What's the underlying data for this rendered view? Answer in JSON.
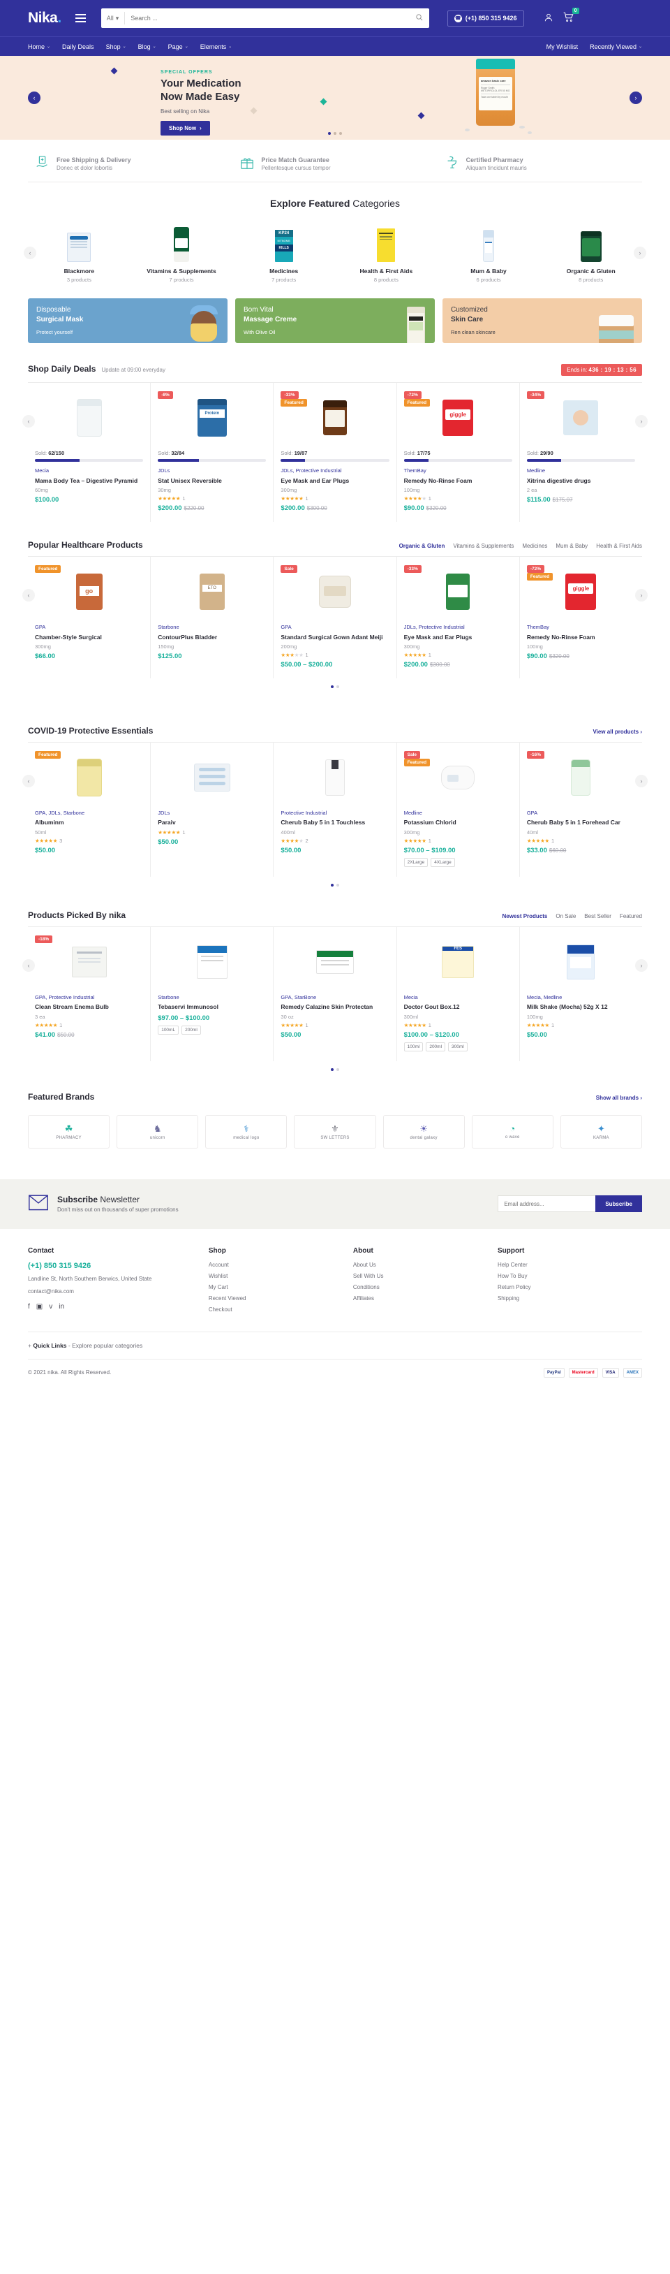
{
  "header": {
    "logo": "Nika",
    "logo_dot": ".",
    "search": {
      "category": "All",
      "placeholder": "Search ...",
      "value": ""
    },
    "phone": "(+1) 850 315 9426",
    "cart_count": "0"
  },
  "nav": {
    "items": [
      {
        "label": "Home",
        "caret": "⌄"
      },
      {
        "label": "Daily Deals",
        "caret": ""
      },
      {
        "label": "Shop",
        "caret": "⌄"
      },
      {
        "label": "Blog",
        "caret": "⌄"
      },
      {
        "label": "Page",
        "caret": "⌄"
      },
      {
        "label": "Elements",
        "caret": "⌄"
      }
    ],
    "right": [
      {
        "label": "My Wishlist",
        "caret": ""
      },
      {
        "label": "Recently Viewed",
        "caret": "⌄"
      }
    ]
  },
  "hero": {
    "eyebrow": "SPECIAL OFFERS",
    "title_line1": "Your Medication",
    "title_line2": "Now Made Easy",
    "subtitle": "Best selling on Nika",
    "button": "Shop Now",
    "button_caret": "›",
    "prev": "‹",
    "next": "›",
    "bottle_brand": "amazon basic care",
    "bottle_name": "Roger Smith",
    "bottle_drug": "METOPROLOL ER 50 MG",
    "bottle_note": "Take one tablet by mouth"
  },
  "features": [
    {
      "icon": "shipping-icon",
      "title": "Free Shipping & Delivery",
      "sub": "Donec et dolor lobortis"
    },
    {
      "icon": "gift-icon",
      "title": "Price Match Guarantee",
      "sub": "Pellentesque cursus tempor"
    },
    {
      "icon": "pharmacy-icon",
      "title": "Certified Pharmacy",
      "sub": "Aliquam tincidunt mauris"
    }
  ],
  "categories_section": {
    "title_bold": "Explore Featured",
    "title_thin": " Categories",
    "prev": "‹",
    "next": "›",
    "items": [
      {
        "name": "Blackmore",
        "count": "3 products"
      },
      {
        "name": "Vitamins & Supplements",
        "count": "7 products"
      },
      {
        "name": "Medicines",
        "count": "7 products"
      },
      {
        "name": "Health & First Aids",
        "count": "8 products"
      },
      {
        "name": "Mum & Baby",
        "count": "6 products"
      },
      {
        "name": "Organic & Gluten",
        "count": "8 products"
      }
    ]
  },
  "promos": [
    {
      "line1": "Disposable",
      "line2": "Surgical Mask",
      "sub": "Protect yourself"
    },
    {
      "line1": "Bom Vital",
      "line2": "Massage Creme",
      "sub": "With Olive Oil"
    },
    {
      "line1": "Customized",
      "line2": "Skin Care",
      "sub": "Ren clean skincare"
    }
  ],
  "daily_deals": {
    "title": "Shop Daily Deals",
    "note": "Update at 09:00 everyday",
    "ends_label": "Ends in:",
    "countdown": "436 : 19 : 13 : 56",
    "prev": "‹",
    "next": "›",
    "products": [
      {
        "tags": [],
        "sold": "Sold: ",
        "sold_val": "62/150",
        "progress": 41,
        "brand": "Mecia",
        "name": "Mama Body Tea – Digestive Pyramid",
        "dose": "60mg",
        "stars": 0,
        "rating_count": "",
        "price": "$100.00",
        "old_price": "",
        "art": "m-bottlewhite"
      },
      {
        "tags": [
          {
            "text": "-8%",
            "color": "red"
          }
        ],
        "sold": "Sold: ",
        "sold_val": "32/84",
        "progress": 38,
        "brand": "JDLs",
        "name": "Stat Unisex Reversible",
        "dose": "30mg",
        "stars": 5,
        "rating_count": "1",
        "price": "$200.00",
        "old_price": "$220.00",
        "art": "m-protein"
      },
      {
        "tags": [
          {
            "text": "-33%",
            "color": "red"
          },
          {
            "text": "Featured",
            "color": "orange"
          }
        ],
        "sold": "Sold: ",
        "sold_val": "19/87",
        "progress": 22,
        "brand": "JDLs, Protective Industrial",
        "name": "Eye Mask and Ear Plugs",
        "dose": "300mg",
        "stars": 5,
        "rating_count": "1",
        "price": "$200.00",
        "old_price": "$300.00",
        "art": "m-amber"
      },
      {
        "tags": [
          {
            "text": "-72%",
            "color": "red"
          },
          {
            "text": "Featured",
            "color": "orange"
          }
        ],
        "sold": "Sold: ",
        "sold_val": "17/75",
        "progress": 23,
        "brand": "ThemBay",
        "name": "Remedy No-Rinse Foam",
        "dose": "100mg",
        "stars": 4,
        "rating_count": "1",
        "price": "$90.00",
        "old_price": "$320.00",
        "art": "m-red"
      },
      {
        "tags": [
          {
            "text": "-34%",
            "color": "red"
          }
        ],
        "sold": "Sold: ",
        "sold_val": "29/90",
        "progress": 32,
        "brand": "Medline",
        "name": "Xitrina digestive drugs",
        "dose": "2 ea",
        "stars": 0,
        "rating_count": "",
        "price": "$115.00",
        "old_price": "$175.07",
        "art": "m-baby"
      }
    ]
  },
  "popular": {
    "title": "Popular Healthcare Products",
    "tabs": [
      {
        "label": "Organic & Gluten",
        "active": true
      },
      {
        "label": "Vitamins & Supplements",
        "active": false
      },
      {
        "label": "Medicines",
        "active": false
      },
      {
        "label": "Mum & Baby",
        "active": false
      },
      {
        "label": "Health & First Aids",
        "active": false
      }
    ],
    "prev": "‹",
    "next": "›",
    "products": [
      {
        "tags": [
          {
            "text": "Featured",
            "color": "orange"
          }
        ],
        "brand": "GPA",
        "name": "Chamber-Style Surgical",
        "dose": "300mg",
        "stars": 0,
        "rating_count": "",
        "price": "$66.00",
        "old_price": "",
        "art": "m-gogo"
      },
      {
        "tags": [],
        "brand": "Starbone",
        "name": "ContourPlus Bladder",
        "dose": "150mg",
        "stars": 0,
        "rating_count": "",
        "price": "$125.00",
        "old_price": "",
        "art": "m-tan"
      },
      {
        "tags": [
          {
            "text": "Sale",
            "color": "red"
          }
        ],
        "brand": "GPA",
        "name": "Standard Surgical Gown Adant Meiji",
        "dose": "200mg",
        "stars": 3,
        "rating_count": "1",
        "price": "$50.00 – $200.00",
        "old_price": "",
        "art": "m-pouch"
      },
      {
        "tags": [
          {
            "text": "-33%",
            "color": "red"
          }
        ],
        "brand": "JDLs, Protective Industrial",
        "name": "Eye Mask and Ear Plugs",
        "dose": "300mg",
        "stars": 5,
        "rating_count": "1",
        "price": "$200.00",
        "old_price": "$300.00",
        "art": "m-green"
      },
      {
        "tags": [
          {
            "text": "-72%",
            "color": "red"
          },
          {
            "text": "Featured",
            "color": "orange"
          }
        ],
        "brand": "ThemBay",
        "name": "Remedy No-Rinse Foam",
        "dose": "100mg",
        "stars": 0,
        "rating_count": "",
        "price": "$90.00",
        "old_price": "$320.00",
        "art": "m-red"
      }
    ]
  },
  "covid": {
    "title": "COVID-19 Protective Essentials",
    "view_all": "View all products",
    "view_all_caret": "›",
    "prev": "‹",
    "next": "›",
    "products": [
      {
        "tags": [
          {
            "text": "Featured",
            "color": "orange"
          }
        ],
        "brand": "GPA, JDLs, Starbone",
        "name": "Albuminm",
        "dose": "50ml",
        "stars": 5,
        "rating_count": "3",
        "price": "$50.00",
        "old_price": "",
        "art": "m-yellowb",
        "variants": []
      },
      {
        "tags": [],
        "brand": "JDLs",
        "name": "Paraiv",
        "dose": "",
        "stars": 5,
        "rating_count": "1",
        "price": "$50.00",
        "old_price": "",
        "art": "m-masks",
        "variants": []
      },
      {
        "tags": [],
        "brand": "Protective Industrial",
        "name": "Cherub Baby 5 in 1 Touchless",
        "dose": "400ml",
        "stars": 4,
        "rating_count": "2",
        "price": "$50.00",
        "old_price": "",
        "art": "m-pump",
        "variants": []
      },
      {
        "tags": [
          {
            "text": "Sale",
            "color": "red"
          },
          {
            "text": "Featured",
            "color": "orange"
          }
        ],
        "brand": "Medline",
        "name": "Potassium Chlorid",
        "dose": "300mg",
        "stars": 5,
        "rating_count": "1",
        "price": "$70.00 – $109.00",
        "old_price": "",
        "art": "m-therm",
        "variants": [
          "2XLarge",
          "4XLarge"
        ]
      },
      {
        "tags": [
          {
            "text": "-16%",
            "color": "red"
          }
        ],
        "brand": "GPA",
        "name": "Cherub Baby 5 in 1 Forehead Car",
        "dose": "40ml",
        "stars": 5,
        "rating_count": "1",
        "price": "$33.00",
        "old_price": "$60.00",
        "art": "m-greenb",
        "variants": []
      }
    ]
  },
  "picked": {
    "title": "Products Picked By nika",
    "tabs": [
      {
        "label": "Newest Products",
        "active": true
      },
      {
        "label": "On Sale",
        "active": false
      },
      {
        "label": "Best Seller",
        "active": false
      },
      {
        "label": "Featured",
        "active": false
      }
    ],
    "prev": "‹",
    "next": "›",
    "products": [
      {
        "tags": [
          {
            "text": "-18%",
            "color": "red"
          }
        ],
        "brand": "GPA, Protective Industrial",
        "name": "Clean Stream Enema Bulb",
        "dose": "3 ea",
        "stars": 5,
        "rating_count": "1",
        "price": "$41.00",
        "old_price": "$50.00",
        "art": "m-boxw",
        "variants": []
      },
      {
        "tags": [],
        "brand": "Starbone",
        "name": "Tebaservi Immunosol",
        "dose": "",
        "stars": 0,
        "rating_count": "",
        "price": "$97.00 – $100.00",
        "old_price": "",
        "art": "m-boxb",
        "variants": [
          "100mL",
          "200ml"
        ]
      },
      {
        "tags": [],
        "brand": "GPA, StarBone",
        "name": "Remedy Calazine Skin Protectan",
        "dose": "30 oz",
        "stars": 5,
        "rating_count": "1",
        "price": "$50.00",
        "old_price": "",
        "art": "m-boxgreen",
        "variants": []
      },
      {
        "tags": [],
        "brand": "Mecia",
        "name": "Doctor Gout Box.12",
        "dose": "300ml",
        "stars": 5,
        "rating_count": "1",
        "price": "$100.00 – $120.00",
        "old_price": "",
        "art": "m-fes",
        "variants": [
          "100ml",
          "200ml",
          "300ml"
        ]
      },
      {
        "tags": [],
        "brand": "Mecia, Medline",
        "name": "Milk Shake (Mocha) 52g X 12",
        "dose": "100mg",
        "stars": 5,
        "rating_count": "1",
        "price": "$50.00",
        "old_price": "",
        "art": "m-otri",
        "variants": []
      }
    ]
  },
  "brands_section": {
    "title": "Featured Brands",
    "show_all": "Show all brands",
    "show_all_caret": "›",
    "items": [
      {
        "icon": "☘",
        "name": "PHARMACY"
      },
      {
        "icon": "♞",
        "name": "unicorn"
      },
      {
        "icon": "⚕",
        "name": "medical logo"
      },
      {
        "icon": "⚜",
        "name": "SW LETTERS"
      },
      {
        "icon": "☀",
        "name": "dental galaxy"
      },
      {
        "icon": "◔",
        "name": "o wave"
      },
      {
        "icon": "✦",
        "name": "KARMA"
      }
    ]
  },
  "newsletter": {
    "title_bold": "Subscribe",
    "title_thin": " Newsletter",
    "sub": "Don't miss out on thousands of super promotions",
    "placeholder": "Email address...",
    "button": "Subscribe"
  },
  "footer": {
    "columns": [
      {
        "heading": "Contact",
        "tel": "(+1) 850 315 9426",
        "address": "Landline St, North Southern Berwics, United State",
        "email": "contact@nika.com",
        "socials": [
          "facebook-icon",
          "instagram-icon",
          "twitter-icon",
          "linkedin-icon"
        ],
        "social_glyphs": [
          "f",
          "▣",
          "ᴠ",
          "in"
        ]
      },
      {
        "heading": "Shop",
        "links": [
          "Account",
          "Wishlist",
          "My Cart",
          "Recent Viewed",
          "Checkout"
        ]
      },
      {
        "heading": "About",
        "links": [
          "About Us",
          "Sell With Us",
          "Conditions",
          "Affiliates"
        ]
      },
      {
        "heading": "Support",
        "links": [
          "Help Center",
          "How To Buy",
          "Return Policy",
          "Shipping"
        ]
      }
    ],
    "quick_plus": "+",
    "quick_bold": "Quick Links",
    "quick_rest": "- Explore popular categories",
    "copyright": "© 2021 nika. All Rights Reserved.",
    "payments": [
      "PayPal",
      "Mastercard",
      "VISA",
      "AMEX"
    ]
  },
  "colors": {
    "brand_blue": "#31319b",
    "teal": "#19b09b",
    "red": "#ec5a5a",
    "orange": "#f0932b",
    "hero_bg": "#faeadd"
  }
}
